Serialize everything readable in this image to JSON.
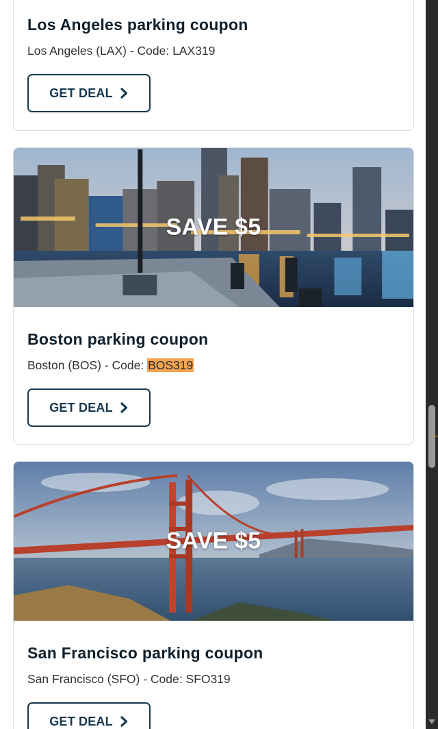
{
  "cards": [
    {
      "title": "Los Angeles parking coupon",
      "location_prefix": "Los Angeles (LAX) - Code: ",
      "code": "LAX319",
      "button_label": "GET DEAL"
    },
    {
      "badge": "SAVE $5",
      "title": "Boston parking coupon",
      "location_prefix": "Boston (BOS) - Code: ",
      "code": "BOS319",
      "code_highlighted": true,
      "button_label": "GET DEAL",
      "image": "boston-harbor-skyline"
    },
    {
      "badge": "SAVE $5",
      "title": "San Francisco parking coupon",
      "location_prefix": "San Francisco (SFO) - Code: ",
      "code": "SFO319",
      "button_label": "GET DEAL",
      "image": "golden-gate-bridge"
    }
  ],
  "icons": {
    "button_arrow": "arrow-right-icon"
  },
  "colors": {
    "title": "#0f1f2b",
    "button_border": "#17384d",
    "highlight": "#f7a44f"
  }
}
